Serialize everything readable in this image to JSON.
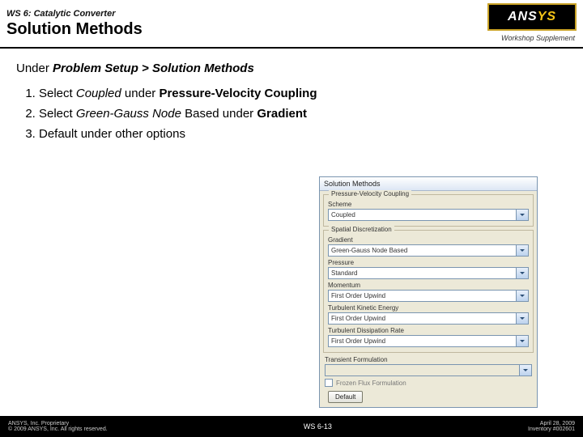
{
  "header": {
    "ws_label": "WS 6: Catalytic Converter",
    "title": "Solution Methods",
    "logo_a": "ANS",
    "logo_b": "YS",
    "supplement": "Workshop Supplement"
  },
  "under": {
    "pre": "Under ",
    "path": "Problem Setup > Solution Methods"
  },
  "steps": {
    "s1a": "Select ",
    "s1b": "Coupled",
    "s1c": " under ",
    "s1d": "Pressure-Velocity Coupling",
    "s2a": "Select ",
    "s2b": "Green-Gauss Node",
    "s2c": " Based under ",
    "s2d": "Gradient",
    "s3": "Default under other options"
  },
  "panel": {
    "title": "Solution Methods",
    "group1": "Pressure-Velocity Coupling",
    "scheme_label": "Scheme",
    "scheme_value": "Coupled",
    "group2": "Spatial Discretization",
    "gradient_label": "Gradient",
    "gradient_value": "Green-Gauss Node Based",
    "pressure_label": "Pressure",
    "pressure_value": "Standard",
    "momentum_label": "Momentum",
    "momentum_value": "First Order Upwind",
    "tke_label": "Turbulent Kinetic Energy",
    "tke_value": "First Order Upwind",
    "tdr_label": "Turbulent Dissipation Rate",
    "tdr_value": "First Order Upwind",
    "trans_label": "Transient Formulation",
    "chk1": "Frozen Flux Formulation",
    "btn": "Default"
  },
  "footer": {
    "left1": "ANSYS, Inc. Proprietary",
    "left2": "© 2009 ANSYS, Inc. All rights reserved.",
    "mid": "WS 6-13",
    "right1": "April 28, 2009",
    "right2": "Inventory #002601"
  }
}
